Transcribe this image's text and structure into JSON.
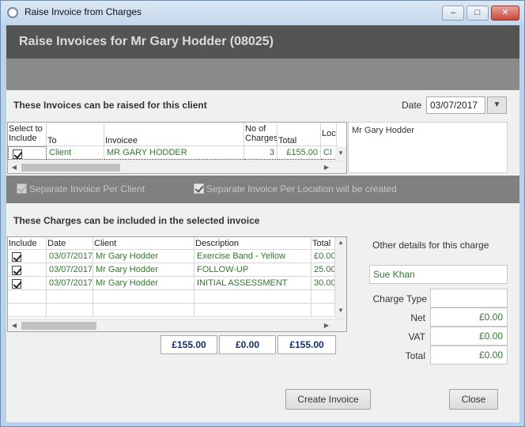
{
  "window": {
    "title": "Raise Invoice from Charges",
    "controls": {
      "minimize": "–",
      "maximize": "□",
      "close": "✕"
    }
  },
  "header": {
    "title": "Raise Invoices for Mr Gary Hodder (08025)"
  },
  "invoices_section": {
    "title": "These Invoices can be raised for this client",
    "date_label": "Date",
    "date_value": "03/07/2017",
    "columns": [
      "Select to Include",
      "To",
      "Invoicee",
      "No of Charges",
      "Total",
      "Loc"
    ],
    "rows": [
      {
        "selected": true,
        "to": "Client",
        "invoicee": "MR GARY HODDER",
        "charges": "3",
        "total": "£155.00",
        "loc": "Cl"
      }
    ],
    "side_panel_text": "Mr Gary Hodder"
  },
  "options": {
    "separate_per_client": "Separate Invoice Per Client",
    "separate_per_location": "Separate Invoice Per Location will be created"
  },
  "charges_section": {
    "title": "These Charges can be included in the selected invoice",
    "columns": [
      "Include",
      "Date",
      "Client",
      "Description",
      "Total"
    ],
    "rows": [
      {
        "include": true,
        "date": "03/07/2017",
        "client": "Mr Gary Hodder",
        "description": "Exercise Band - Yellow",
        "total": "£0.00"
      },
      {
        "include": true,
        "date": "03/07/2017",
        "client": "Mr Gary Hodder",
        "description": "FOLLOW-UP",
        "total": "25.00"
      },
      {
        "include": true,
        "date": "03/07/2017",
        "client": "Mr Gary Hodder",
        "description": "INITIAL ASSESSMENT",
        "total": "30.00"
      }
    ],
    "totals": [
      "£155.00",
      "£0.00",
      "£155.00"
    ]
  },
  "other_details": {
    "title": "Other details for this charge",
    "staff": "Sue Khan",
    "charge_type_label": "Charge Type",
    "charge_type_value": "",
    "net_label": "Net",
    "net_value": "£0.00",
    "vat_label": "VAT",
    "vat_value": "£0.00",
    "total_label": "Total",
    "total_value": "£0.00"
  },
  "buttons": {
    "create_invoice": "Create Invoice",
    "close": "Close"
  },
  "colors": {
    "header_dark": "#545454",
    "header_mid": "#8a8a8a",
    "value_green": "#2e7a2e",
    "value_navy": "#0f2f70"
  }
}
